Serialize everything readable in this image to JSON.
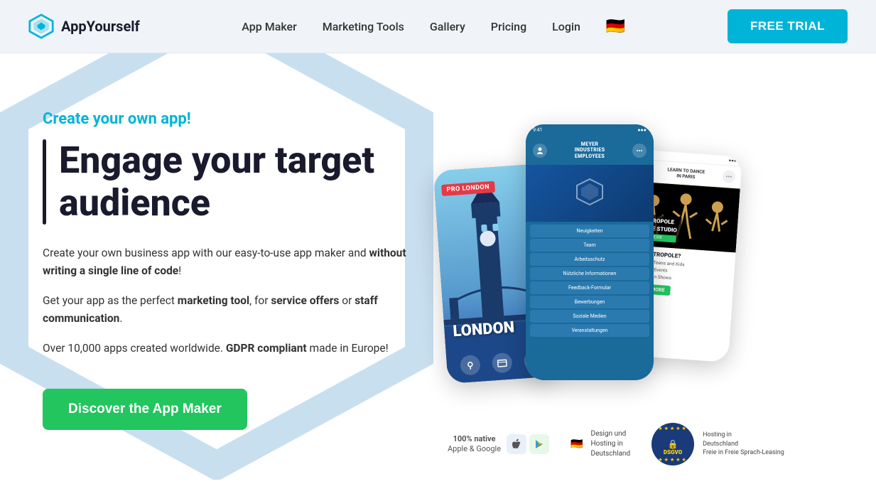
{
  "nav": {
    "logo_text": "AppYourself",
    "links": [
      {
        "id": "app-maker",
        "label": "App Maker"
      },
      {
        "id": "marketing-tools",
        "label": "Marketing Tools"
      },
      {
        "id": "gallery",
        "label": "Gallery"
      },
      {
        "id": "pricing",
        "label": "Pricing"
      },
      {
        "id": "login",
        "label": "Login"
      }
    ],
    "cta_label": "FREE TRIAL",
    "flag": "🇩🇪"
  },
  "hero": {
    "tagline": "Create your own app!",
    "headline_line1": "Engage your target",
    "headline_line2": "audience",
    "body1": "Create your own business app with our easy-to-use app maker and ",
    "body1_bold": "without writing a single line of code",
    "body1_end": "!",
    "body2_start": "Get your app as the perfect ",
    "body2_bold1": "marketing tool",
    "body2_mid": ", for ",
    "body2_bold2": "service offers",
    "body2_end": " or ",
    "body2_bold3": "staff communication",
    "body2_dot": ".",
    "body3_start": "Over 10,000 apps created worldwide. ",
    "body3_bold": "GDPR compliant",
    "body3_end": " made in Europe!",
    "cta_label": "Discover the App Maker"
  },
  "badges": {
    "native_label": "100% native",
    "platforms_label": "Apple & Google",
    "design_label": "Design und\nHosting in\nDeutschland",
    "dsgvo_label": "DSGVO"
  },
  "phones": {
    "left": {
      "label": "PRO LONDON",
      "city": "LONDON"
    },
    "center": {
      "company": "MEYER\nINDUSTRIES\nEMPLOYEES",
      "menu": [
        "Neuigkeiten",
        "Team",
        "Arbeitsschutz",
        "Nützliche Informationen",
        "Feedback-Formular",
        "Bewerbungen",
        "Soziale Medien",
        "Veranstaltungen"
      ]
    },
    "right": {
      "header": "LEARN TO DANCE\nIN PARIS",
      "badge_title": "METROPOLE\nDANCE STUDIO",
      "sub": "WHY METROPOLE?",
      "details": "For Adults, Teens and Kids\nParticipate in Shows"
    }
  }
}
